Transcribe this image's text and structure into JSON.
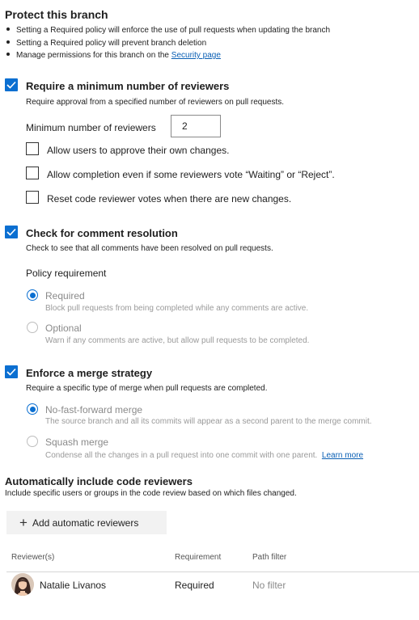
{
  "page": {
    "title": "Protect this branch",
    "bullets": [
      "Setting a Required policy will enforce the use of pull requests when updating the branch",
      "Setting a Required policy will prevent branch deletion",
      "Manage permissions for this branch on the "
    ],
    "security_link": "Security page"
  },
  "reviewers": {
    "checked": true,
    "title": "Require a minimum number of reviewers",
    "description": "Require approval from a specified number of reviewers on pull requests.",
    "min_label": "Minimum number of reviewers",
    "min_value": "2",
    "options": [
      {
        "label": "Allow users to approve their own changes.",
        "checked": false
      },
      {
        "label": "Allow completion even if some reviewers vote “Waiting” or “Reject”.",
        "checked": false
      },
      {
        "label": "Reset code reviewer votes when there are new changes.",
        "checked": false
      }
    ]
  },
  "comments": {
    "checked": true,
    "title": "Check for comment resolution",
    "description": "Check to see that all comments have been resolved on pull requests.",
    "policy_label": "Policy requirement",
    "required_label": "Required",
    "required_desc": "Block pull requests from being completed while any comments are active.",
    "optional_label": "Optional",
    "optional_desc": "Warn if any comments are active, but allow pull requests to be completed.",
    "selected": "Required"
  },
  "merge": {
    "checked": true,
    "title": "Enforce a merge strategy",
    "description": "Require a specific type of merge when pull requests are completed.",
    "noff_label": "No-fast-forward merge",
    "noff_desc": "The source branch and all its commits will appear as a second parent to the merge commit.",
    "squash_label": "Squash merge",
    "squash_desc": "Condense all the changes in a pull request into one commit with one parent.",
    "learn_more": "Learn more",
    "selected": "No-fast-forward merge"
  },
  "auto_reviewers": {
    "title": "Automatically include code reviewers",
    "description": "Include specific users or groups in the code review based on which files changed.",
    "add_button": "Add automatic reviewers",
    "columns": [
      "Reviewer(s)",
      "Requirement",
      "Path filter"
    ],
    "rows": [
      {
        "reviewer": "Natalie Livanos",
        "requirement": "Required",
        "path_filter": "No filter"
      }
    ]
  },
  "colors": {
    "accent": "#0b6fd1",
    "link": "#0a5fb4"
  }
}
